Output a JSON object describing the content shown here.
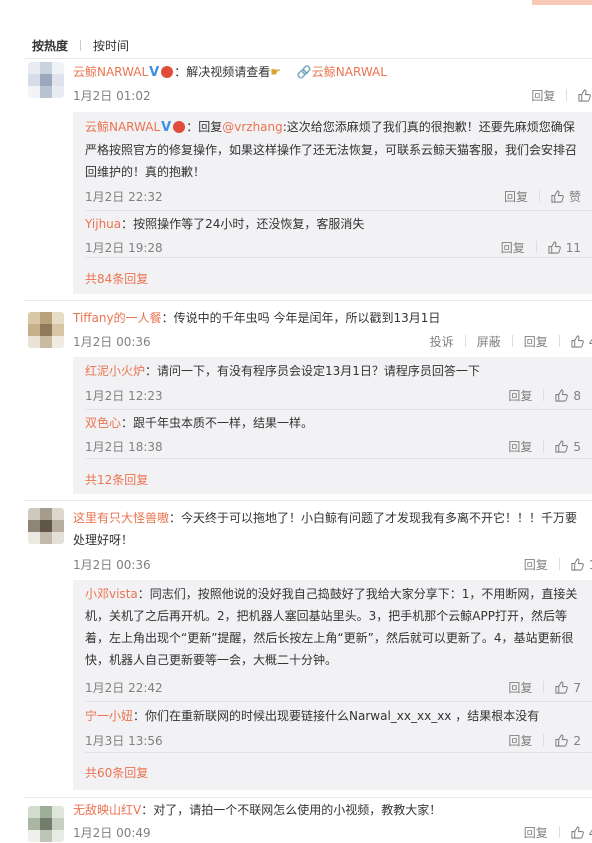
{
  "sort": {
    "hot": "按热度",
    "time": "按时间"
  },
  "comments": [
    {
      "user": "云鲸NARWAL",
      "text": "：解决视频请查看",
      "link": "云鲸NARWAL",
      "time": "1月2日 01:02",
      "reply_label": "回复",
      "likes": "7",
      "replies": [
        {
          "user": "云鲸NARWAL",
          "text_pre": "：回复",
          "mention": "@vrzhang",
          "text": ":这次给您添麻烦了我们真的很抱歉！还要先麻烦您确保严格按照官方的修复操作，如果这样操作了还无法恢复，可联系云鲸天猫客服，我们会安排召回维护的！真的抱歉！",
          "time": "1月2日 22:32",
          "reply_label": "回复",
          "like_label": "赞"
        },
        {
          "user": "Yijhua",
          "text": "：按照操作等了24小时，还没恢复，客服消失",
          "time": "1月2日 19:28",
          "reply_label": "回复",
          "likes": "11"
        }
      ],
      "more": "共84条回复"
    },
    {
      "user": "Tiffany的一人餐",
      "text": "：传说中的千年虫吗 今年是闰年，所以戳到13月1日",
      "time": "1月2日 00:36",
      "report_label": "投诉",
      "block_label": "屏蔽",
      "reply_label": "回复",
      "likes": "46",
      "replies": [
        {
          "user": "红泥小火炉",
          "text": "：请问一下，有没有程序员会设定13月1日？请程序员回答一下",
          "time": "1月2日 12:23",
          "reply_label": "回复",
          "likes": "8"
        },
        {
          "user": "双色心",
          "text": "：跟千年虫本质不一样，结果一样。",
          "time": "1月2日 18:38",
          "reply_label": "回复",
          "likes": "5"
        }
      ],
      "more": "共12条回复"
    },
    {
      "user": "这里有只大怪兽嗷",
      "text": "：今天终于可以拖地了！小白鲸有问题了才发现我有多离不开它！！！千万要处理好呀！",
      "time": "1月2日 00:36",
      "reply_label": "回复",
      "likes": "13",
      "replies": [
        {
          "user": "小邓vista",
          "text": "：同志们，按照他说的没好我自己捣鼓好了我给大家分享下：1，不用断网，直接关机，关机了之后再开机。2，把机器人塞回基站里头。3，把手机那个云鲸APP打开，然后等着，左上角出现个“更新”提醒，然后长按左上角“更新”，然后就可以更新了。4，基站更新很快，机器人自己更新要等一会，大概二十分钟。",
          "time": "1月2日 22:42",
          "reply_label": "回复",
          "likes": "7"
        },
        {
          "user": "宁一小妞",
          "text": "：你们在重新联网的时候出现要链接什么Narwal_xx_xx_xx ，结果根本没有",
          "time": "1月3日 13:56",
          "reply_label": "回复",
          "likes": "2"
        }
      ],
      "more": "共60条回复"
    },
    {
      "user": "无敌映山红V",
      "text": "：对了，请拍一个不联网怎么使用的小视频，教教大家！",
      "time": "1月2日 00:49",
      "reply_label": "回复",
      "likes": "40"
    }
  ]
}
